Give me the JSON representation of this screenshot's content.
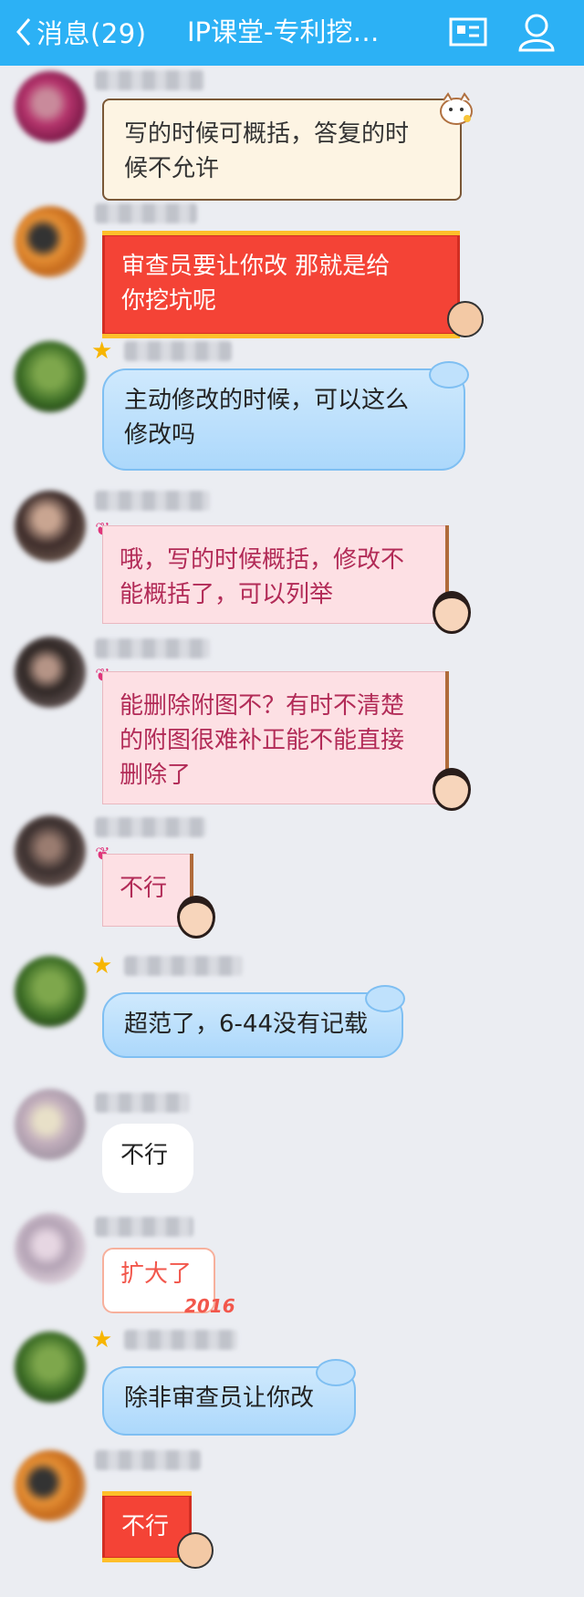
{
  "header": {
    "back_label": "消息(29)",
    "title": "IP课堂-专利挖…",
    "icons": [
      "back-chevron-icon",
      "group-card-icon",
      "member-icon"
    ]
  },
  "colors": {
    "header_bg": "#2cb1f5",
    "chat_bg": "#ebedf2",
    "red_bubble": "#f44336",
    "pink_bubble": "#fde0e4",
    "pink_text": "#b22b57",
    "blue_bubble": "#bfe1fc"
  },
  "messages": [
    {
      "style": "cream",
      "text": [
        "写的时候可概括，答复的时",
        "候不允许"
      ]
    },
    {
      "style": "red",
      "text": [
        "审查员要让你改  那就是给",
        "你挖坑呢"
      ]
    },
    {
      "style": "blue",
      "text": [
        "主动修改的时候，可以这么",
        "修改吗"
      ]
    },
    {
      "style": "pink",
      "text": [
        "哦，写的时候概括，修改不",
        "能概括了，可以列举"
      ]
    },
    {
      "style": "pink",
      "text": [
        "能删除附图不？有时不清楚",
        "的附图很难补正能不能直接",
        "删除了"
      ]
    },
    {
      "style": "pink",
      "text": [
        "不行"
      ]
    },
    {
      "style": "blue",
      "text": [
        "超范了，6-44没有记载"
      ]
    },
    {
      "style": "white",
      "text": [
        "不行"
      ]
    },
    {
      "style": "outline",
      "text": [
        "扩大了"
      ],
      "sticker": "2016"
    },
    {
      "style": "blue",
      "text": [
        "除非审查员让你改"
      ]
    },
    {
      "style": "red",
      "text": [
        "不行"
      ]
    }
  ]
}
